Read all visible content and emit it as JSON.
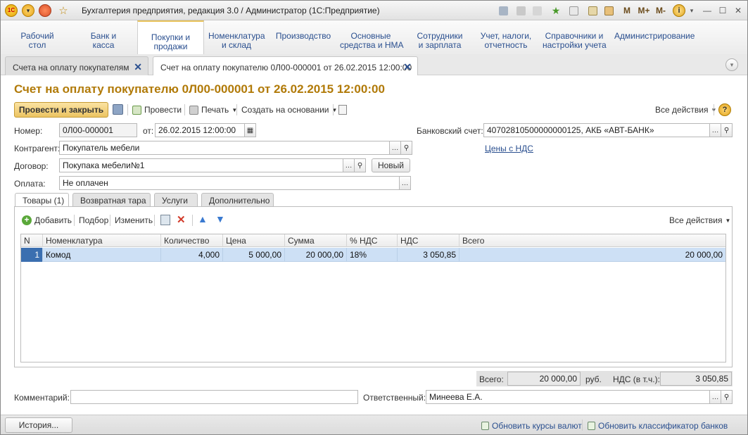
{
  "window": {
    "title": "Бухгалтерия предприятия, редакция 3.0 / Администратор  (1С:Предприятие)",
    "controls": {
      "memory": "M",
      "memory_plus": "M+",
      "memory_minus": "M-",
      "info": "i",
      "minimize": "—",
      "maximize": "☐",
      "close": "✕"
    }
  },
  "sections": [
    {
      "label": "Рабочий\nстол"
    },
    {
      "label": "Банк и\nкасса"
    },
    {
      "label": "Покупки и\nпродажи"
    },
    {
      "label": "Номенклатура\nи склад"
    },
    {
      "label": "Производство"
    },
    {
      "label": "Основные\nсредства и НМА"
    },
    {
      "label": "Сотрудники\nи зарплата"
    },
    {
      "label": "Учет, налоги,\nотчетность"
    },
    {
      "label": "Справочники и\nнастройки учета"
    },
    {
      "label": "Администрирование"
    }
  ],
  "open_tabs": [
    {
      "label": "Счета на оплату покупателям"
    },
    {
      "label": "Счет на оплату покупателю 0Л00-000001 от 26.02.2015 12:00:00"
    }
  ],
  "document": {
    "title": "Счет на оплату покупателю 0Л00-000001 от 26.02.2015 12:00:00",
    "toolbar": {
      "post_close": "Провести и закрыть",
      "post": "Провести",
      "print": "Печать",
      "create_based": "Создать на основании",
      "all_actions": "Все действия",
      "help": "?"
    },
    "fields": {
      "number_label": "Номер:",
      "number": "0Л00-000001",
      "date_label": "от:",
      "date": "26.02.2015 12:00:00",
      "bank_label": "Банковский счет:",
      "bank": "40702810500000000125, АКБ «АВТ-БАНК»",
      "prices_link": "Цены с НДС",
      "counterparty_label": "Контрагент:",
      "counterparty": "Покупатель мебели",
      "contract_label": "Договор:",
      "contract": "Покупака мебели№1",
      "new_button": "Новый",
      "payment_label": "Оплата:",
      "payment": "Не оплачен"
    },
    "page_tabs": [
      "Товары (1)",
      "Возвратная тара",
      "Услуги",
      "Дополнительно"
    ],
    "table_toolbar": {
      "add": "Добавить",
      "pick": "Подбор",
      "edit": "Изменить",
      "all_actions": "Все действия"
    },
    "columns": [
      "N",
      "Номенклатура",
      "Количество",
      "Цена",
      "Сумма",
      "% НДС",
      "НДС",
      "Всего"
    ],
    "rows": [
      {
        "n": "1",
        "item": "Комод",
        "qty": "4,000",
        "price": "5 000,00",
        "sum": "20 000,00",
        "vat_rate": "18%",
        "vat": "3 050,85",
        "total": "20 000,00"
      }
    ],
    "totals": {
      "total_label": "Всего:",
      "total": "20 000,00",
      "currency": "руб.",
      "vat_label": "НДС (в т.ч.):",
      "vat": "3 050,85"
    },
    "comment_label": "Комментарий:",
    "comment": "",
    "responsible_label": "Ответственный:",
    "responsible": "Минеева Е.А."
  },
  "statusbar": {
    "history": "История...",
    "update_rates": "Обновить курсы валют",
    "update_banks": "Обновить классификатор банков"
  },
  "colors": {
    "accent": "#b17a08",
    "primary_button": "#ecc462",
    "selected_row": "#cde0f5",
    "link": "#2a4f8f"
  }
}
